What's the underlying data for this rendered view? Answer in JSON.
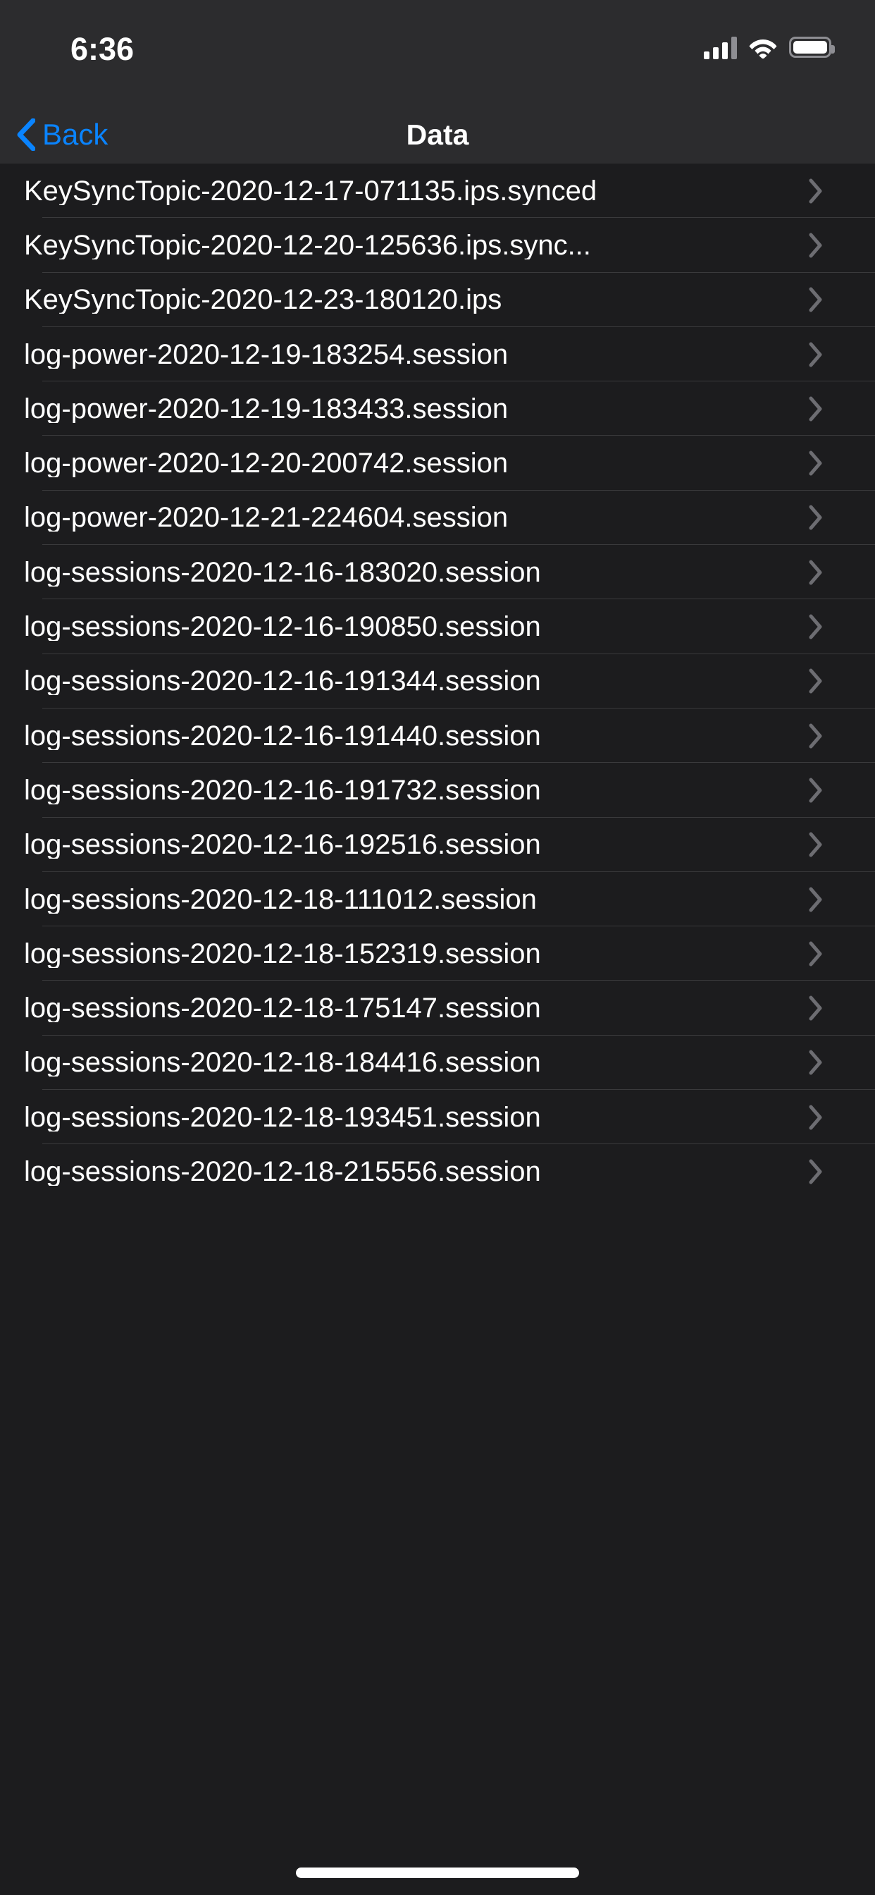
{
  "statusbar": {
    "time": "6:36",
    "cellular_icon": "cellular-signal-icon",
    "wifi_icon": "wifi-icon",
    "battery_icon": "battery-icon"
  },
  "navbar": {
    "back_label": "Back",
    "back_icon": "chevron-left-icon",
    "title": "Data",
    "accent_color": "#0a84ff",
    "background_color": "#2c2c2e"
  },
  "list": {
    "background_color": "#1c1c1e",
    "separator_color": "#3a3a3c",
    "disclosure_icon": "chevron-right-icon",
    "rows": [
      {
        "label": "KeySyncTopic-2020-12-17-071135.ips.synced"
      },
      {
        "label": "KeySyncTopic-2020-12-20-125636.ips.sync..."
      },
      {
        "label": "KeySyncTopic-2020-12-23-180120.ips"
      },
      {
        "label": "log-power-2020-12-19-183254.session"
      },
      {
        "label": "log-power-2020-12-19-183433.session"
      },
      {
        "label": "log-power-2020-12-20-200742.session"
      },
      {
        "label": "log-power-2020-12-21-224604.session"
      },
      {
        "label": "log-sessions-2020-12-16-183020.session"
      },
      {
        "label": "log-sessions-2020-12-16-190850.session"
      },
      {
        "label": "log-sessions-2020-12-16-191344.session"
      },
      {
        "label": "log-sessions-2020-12-16-191440.session"
      },
      {
        "label": "log-sessions-2020-12-16-191732.session"
      },
      {
        "label": "log-sessions-2020-12-16-192516.session"
      },
      {
        "label": "log-sessions-2020-12-18-111012.session"
      },
      {
        "label": "log-sessions-2020-12-18-152319.session"
      },
      {
        "label": "log-sessions-2020-12-18-175147.session"
      },
      {
        "label": "log-sessions-2020-12-18-184416.session"
      },
      {
        "label": "log-sessions-2020-12-18-193451.session"
      },
      {
        "label": "log-sessions-2020-12-18-215556.session"
      }
    ]
  },
  "home_indicator": {
    "name": "home-indicator"
  }
}
